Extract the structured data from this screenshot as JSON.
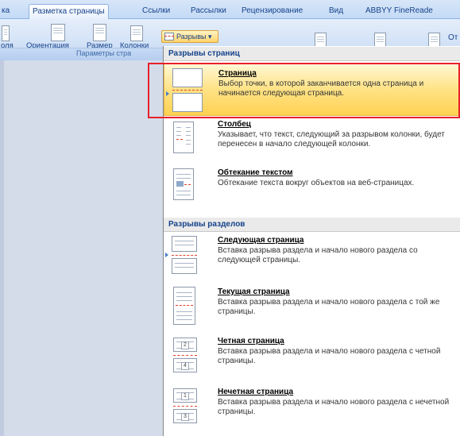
{
  "ribbon": {
    "tabs": [
      {
        "label": "ка"
      },
      {
        "label": "Разметка страницы"
      },
      {
        "label": "Ссылки"
      },
      {
        "label": "Рассылки"
      },
      {
        "label": "Рецензирование"
      },
      {
        "label": "Вид"
      },
      {
        "label": "ABBYY FineReade"
      }
    ],
    "buttons": {
      "margins": "оля",
      "orientation": "Ориентация",
      "size": "Размер",
      "columns": "Колонки",
      "breaks": "Разрывы",
      "truncated": "От"
    },
    "group_label": "Параметры стра"
  },
  "menu": {
    "page_breaks_header": "Разрывы страниц",
    "section_breaks_header": "Разрывы разделов",
    "items": [
      {
        "title": "Страница",
        "description": "Выбор точки, в которой заканчивается одна страница и начинается следующая страница."
      },
      {
        "title": "Столбец",
        "description": "Указывает, что текст, следующий за разрывом колонки, будет перенесен в начало следующей колонки."
      },
      {
        "title": "Обтекание текстом",
        "description": "Обтекание текста вокруг объектов на веб-страницах."
      },
      {
        "title": "Следующая страница",
        "description": "Вставка разрыва раздела и начало нового раздела со следующей страницы."
      },
      {
        "title": "Текущая страница",
        "description": "Вставка разрыва раздела и начало нового раздела с той же страницы."
      },
      {
        "title": "Четная страница",
        "description": "Вставка разрыва раздела и начало нового раздела с четной страницы.",
        "icon_number": "2"
      },
      {
        "title": "Нечетная страница",
        "description": "Вставка разрыва раздела и начало нового раздела с нечетной страницы.",
        "icon_number": "1"
      }
    ],
    "even_icon_next": "4",
    "odd_icon_next": "3"
  },
  "colors": {
    "highlight": "#ffd151",
    "selection_box": "#e8202a",
    "section_header": "#eaeaea"
  }
}
